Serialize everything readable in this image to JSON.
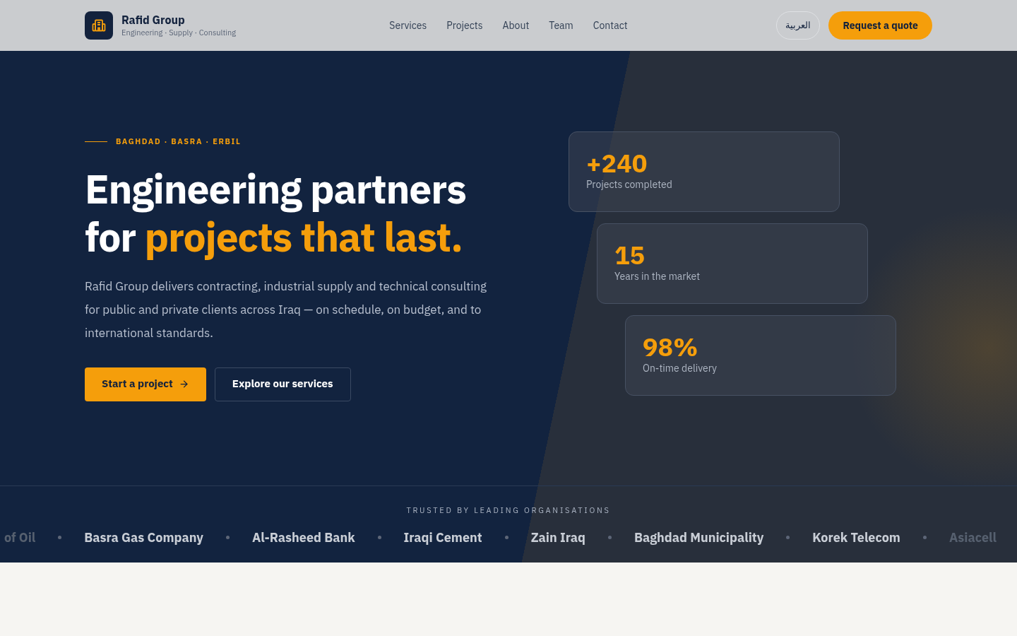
{
  "brand": {
    "name": "Rafid Group",
    "tagline": "Engineering · Supply · Consulting"
  },
  "nav": [
    "Services",
    "Projects",
    "About",
    "Team",
    "Contact"
  ],
  "language_button": "العربية",
  "cta_button": "Request a quote",
  "hero": {
    "eyebrow": "BAGHDAD · BASRA · ERBIL",
    "title_plain": "Engineering partners for ",
    "title_highlight": "projects that last.",
    "body": "Rafid Group delivers contracting, industrial supply and technical consulting for public and private clients across Iraq — on schedule, on budget, and to international standards.",
    "primary_button": "Start a project",
    "secondary_button": "Explore our services"
  },
  "stats": [
    {
      "value": "+240",
      "label": "Projects completed"
    },
    {
      "value": "15",
      "label": "Years in the market"
    },
    {
      "value": "98%",
      "label": "On-time delivery"
    }
  ],
  "trusted": {
    "heading": "TRUSTED BY LEADING ORGANISATIONS",
    "logos": [
      {
        "name": "of Oil",
        "faded": true
      },
      {
        "name": "Basra Gas Company",
        "faded": false
      },
      {
        "name": "Al-Rasheed Bank",
        "faded": false
      },
      {
        "name": "Iraqi Cement",
        "faded": false
      },
      {
        "name": "Zain Iraq",
        "faded": false
      },
      {
        "name": "Baghdad Municipality",
        "faded": false
      },
      {
        "name": "Korek Telecom",
        "faded": false
      },
      {
        "name": "Asiacell",
        "faded": true
      }
    ]
  }
}
